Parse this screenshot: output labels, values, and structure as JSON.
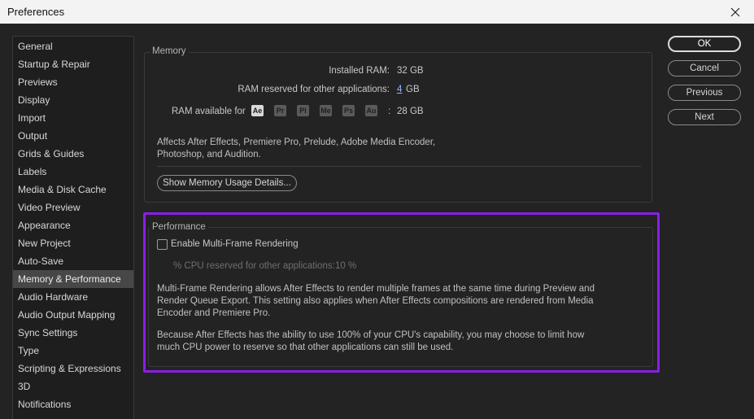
{
  "window": {
    "title": "Preferences",
    "close_icon": "close-icon"
  },
  "sidebar": {
    "items": [
      {
        "label": "General"
      },
      {
        "label": "Startup & Repair"
      },
      {
        "label": "Previews"
      },
      {
        "label": "Display"
      },
      {
        "label": "Import"
      },
      {
        "label": "Output"
      },
      {
        "label": "Grids & Guides"
      },
      {
        "label": "Labels"
      },
      {
        "label": "Media & Disk Cache"
      },
      {
        "label": "Video Preview"
      },
      {
        "label": "Appearance"
      },
      {
        "label": "New Project"
      },
      {
        "label": "Auto-Save"
      },
      {
        "label": "Memory & Performance",
        "selected": true
      },
      {
        "label": "Audio Hardware"
      },
      {
        "label": "Audio Output Mapping"
      },
      {
        "label": "Sync Settings"
      },
      {
        "label": "Type"
      },
      {
        "label": "Scripting & Expressions"
      },
      {
        "label": "3D"
      },
      {
        "label": "Notifications"
      }
    ]
  },
  "memory": {
    "title": "Memory",
    "installed_ram_label": "Installed RAM:",
    "installed_ram_value": "32 GB",
    "reserved_label": "RAM reserved for other applications:",
    "reserved_value": "4",
    "reserved_unit": "GB",
    "available_label": "RAM available for",
    "apps": [
      "Ae",
      "Pr",
      "Pl",
      "Me",
      "Ps",
      "Au"
    ],
    "available_sep": ":",
    "available_value": "28 GB",
    "note_line1": "Affects After Effects, Premiere Pro, Prelude, Adobe Media Encoder,",
    "note_line2": "Photoshop, and Audition.",
    "details_button": "Show Memory Usage Details..."
  },
  "performance": {
    "title": "Performance",
    "mfr_label": "Enable Multi-Frame Rendering",
    "mfr_checked": false,
    "cpu_label": "% CPU reserved for other applications:",
    "cpu_value": "10 %",
    "para1_line1": "Multi-Frame Rendering allows After Effects to render multiple frames at the same time during Preview and",
    "para1_line2": "Render Queue Export. This setting also applies when After Effects compositions are rendered from Media",
    "para1_line3": "Encoder and Premiere Pro.",
    "para2_line1": "Because After Effects has the ability to use 100% of your CPU's capability, you may choose to limit how",
    "para2_line2": "much CPU power to reserve so that other applications can still be used.",
    "highlight_color": "#8a1ee6"
  },
  "buttons": {
    "ok": "OK",
    "cancel": "Cancel",
    "previous": "Previous",
    "next": "Next"
  }
}
